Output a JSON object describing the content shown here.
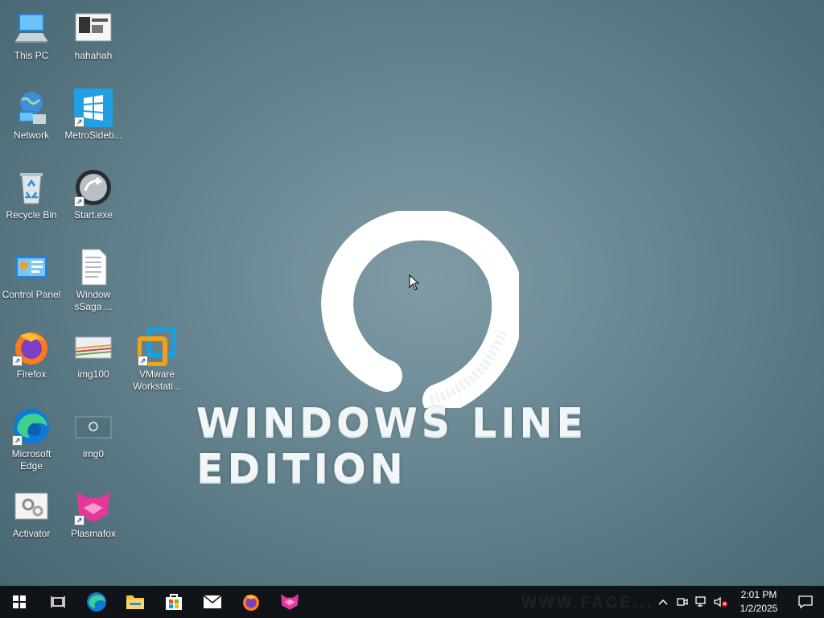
{
  "desktop": {
    "wallpaper_title": "Windows Line Edition",
    "icons": [
      {
        "label": "This PC",
        "icon": "this-pc-icon"
      },
      {
        "label": "hahahah",
        "icon": "image-file-icon"
      },
      {
        "label": "Network",
        "icon": "network-icon"
      },
      {
        "label": "MetroSideb...",
        "icon": "metro-sidebar-icon"
      },
      {
        "label": "Recycle Bin",
        "icon": "recycle-bin-icon"
      },
      {
        "label": "Start.exe",
        "icon": "start-exe-icon"
      },
      {
        "label": "Control Panel",
        "icon": "control-panel-icon"
      },
      {
        "label": "Window sSaga ...",
        "icon": "text-document-icon"
      },
      {
        "label": "Firefox",
        "icon": "firefox-icon"
      },
      {
        "label": "img100",
        "icon": "image-file-icon"
      },
      {
        "label": "VMware Workstati...",
        "icon": "vmware-icon"
      },
      {
        "label": "Microsoft Edge",
        "icon": "edge-icon"
      },
      {
        "label": "img0",
        "icon": "image-file-icon"
      },
      {
        "label": "Activator",
        "icon": "activator-icon"
      },
      {
        "label": "Plasmafox",
        "icon": "plasmafox-icon"
      }
    ]
  },
  "taskbar": {
    "pinned": [
      "start-icon",
      "task-view-icon",
      "edge-icon",
      "file-explorer-icon",
      "store-icon",
      "mail-icon",
      "firefox-icon",
      "plasmafox-icon"
    ],
    "tray": [
      "chevron-up-icon",
      "meet-now-icon",
      "network-icon",
      "volume-muted-icon"
    ],
    "time": "2:01 PM",
    "date": "1/2/2025",
    "watermark": "WWW.FACE..."
  },
  "colors": {
    "wallpaper_center": "#7f9ba6",
    "wallpaper_edge": "#456470",
    "taskbar": "#101418"
  }
}
